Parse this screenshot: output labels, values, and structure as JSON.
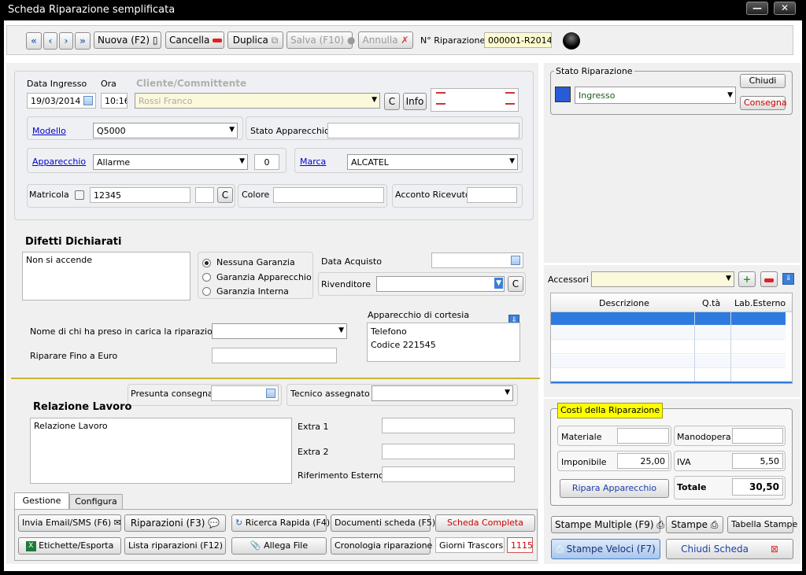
{
  "window": {
    "title": "Scheda Riparazione semplificata",
    "min": "—",
    "close": "✕"
  },
  "toolbar": {
    "first": "«",
    "prev": "‹",
    "next": "›",
    "last": "»",
    "nuova": "Nuova (F2)",
    "cancella": "Cancella",
    "duplica": "Duplica",
    "salva": "Salva (F10)",
    "annulla": "Annulla",
    "nriparazione_label": "N° Riparazione",
    "nriparazione": "000001-R2014"
  },
  "header": {
    "data_label": "Data Ingresso",
    "data": "19/03/2014",
    "ora_label": "Ora",
    "ora": "10:16",
    "cliente_label": "Cliente/Committente",
    "cliente": "Rossi Franco",
    "c": "C",
    "info": "Info"
  },
  "device": {
    "modello_label": "Modello",
    "modello": "Q5000",
    "stato_label": "Stato Apparecchio",
    "stato": "",
    "apparecchio_label": "Apparecchio",
    "apparecchio": "Allarme",
    "qty": "0",
    "marca_label": "Marca",
    "marca": "ALCATEL",
    "matricola_label": "Matricola",
    "matricola": "12345",
    "c2": "C",
    "colore_label": "Colore",
    "colore": "",
    "acconto_label": "Acconto Ricevuto",
    "acconto": ""
  },
  "difetti": {
    "title": "Difetti Dichiarati",
    "text": "Non si accende",
    "garanzie": [
      "Nessuna Garanzia",
      "Garanzia Apparecchio",
      "Garanzia Interna"
    ],
    "data_acquisto_label": "Data Acquisto",
    "rivenditore_label": "Rivenditore",
    "c3": "C"
  },
  "presa": {
    "label": "Nome di chi ha preso in carica la riparazione",
    "riparare_label": "Riparare Fino a Euro",
    "cortesia_label": "Apparecchio di cortesia",
    "cortesia_line1": "Telefono",
    "cortesia_line2": "Codice 221545"
  },
  "lavoro": {
    "presunta_label": "Presunta consegna",
    "tecnico_label": "Tecnico assegnato",
    "title": "Relazione Lavoro",
    "text": "Relazione Lavoro",
    "extra1": "Extra 1",
    "extra2": "Extra 2",
    "rif": "Riferimento Esterno"
  },
  "tabs": [
    "Gestione",
    "Configura"
  ],
  "actions": {
    "email": "Invia Email/SMS (F6)",
    "riparazioni": "Riparazioni (F3)",
    "ricerca": "Ricerca Rapida (F4)",
    "documenti": "Documenti scheda (F5)",
    "scheda": "Scheda Completa",
    "etichette": "Etichette/Esporta",
    "lista": "Lista riparazioni (F12)",
    "allega": "Allega File",
    "cronologia": "Cronologia riparazione",
    "giorni_label": "Giorni Trascorsi",
    "giorni": "1115"
  },
  "stato": {
    "title": "Stato Riparazione",
    "value": "Ingresso",
    "chiudi": "Chiudi",
    "consegna": "Consegna",
    "color": "#2a5bd7"
  },
  "accessori": {
    "label": "Accessori",
    "cols": [
      "Descrizione",
      "Q.tà",
      "Lab.Esterno"
    ]
  },
  "costi": {
    "title": "Costi della Riparazione",
    "materiale_label": "Materiale",
    "manodopera_label": "Manodopera",
    "imponibile_label": "Imponibile",
    "imponibile": "25,00",
    "iva_label": "IVA",
    "iva": "5,50",
    "ripara": "Ripara Apparecchio",
    "totale_label": "Totale",
    "totale": "30,50"
  },
  "footer": {
    "stampe_multiple": "Stampe Multiple (F9)",
    "stampe": "Stampe",
    "tabella": "Tabella Stampe",
    "veloci": "Stampe Veloci (F7)",
    "chiudi": "Chiudi Scheda"
  }
}
